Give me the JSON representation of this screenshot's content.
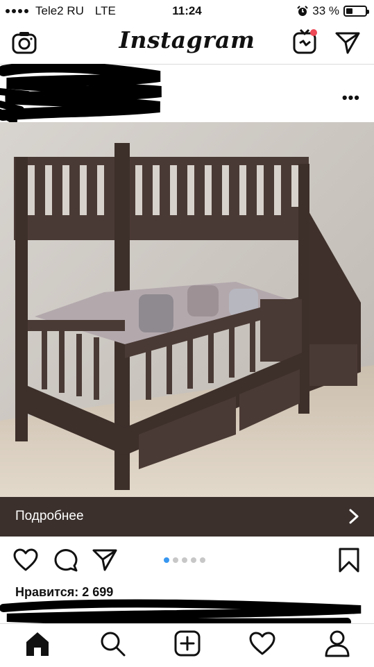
{
  "status_bar": {
    "carrier": "Tele2 RU",
    "network": "LTE",
    "time": "11:24",
    "battery_percent": "33 %",
    "battery_level": 0.33
  },
  "header": {
    "title": "Instagram",
    "icons": [
      "camera-icon",
      "igtv-icon",
      "direct-message-icon"
    ]
  },
  "post": {
    "more_icon": "more-options-icon",
    "cta_label": "Подробнее",
    "carousel": {
      "count": 5,
      "active": 1
    },
    "likes_text": "Нравится: 2 699",
    "actions": [
      "like-icon",
      "comment-icon",
      "share-icon",
      "bookmark-icon"
    ]
  },
  "tab_bar": {
    "tabs": [
      "home-icon",
      "search-icon",
      "new-post-icon",
      "activity-icon",
      "profile-icon"
    ]
  },
  "colors": {
    "accent_blue": "#3897f0",
    "cta_bar": "#3b302c",
    "notification_red": "#ed4956",
    "wood": "#4a3a35"
  }
}
